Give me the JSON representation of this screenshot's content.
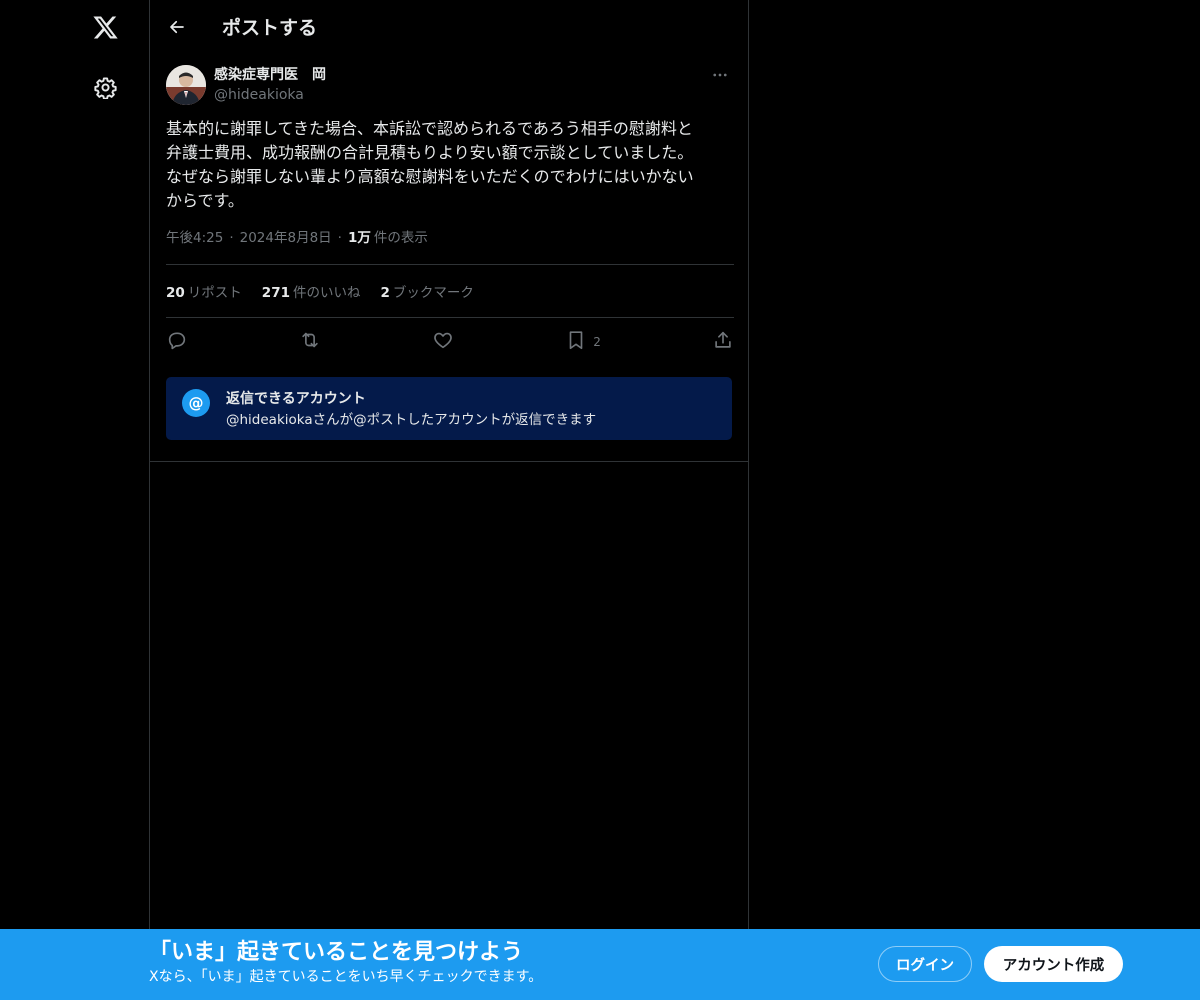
{
  "nav": {
    "logo_icon": "x-logo-icon",
    "settings_icon": "gear-icon"
  },
  "header": {
    "title": "ポストする",
    "back_icon": "arrow-left-icon"
  },
  "post": {
    "author_name": "感染症専門医　岡",
    "author_handle": "@hideakioka",
    "text": "基本的に謝罪してきた場合、本訴訟で認められるであろう相手の慰謝料と\n弁護士費用、成功報酬の合計見積もりより安い額で示談としていました。\nなぜなら謝罪しない輩より高額な慰謝料をいただくのでわけにはいかない\nからです。",
    "time": "午後4:25",
    "date": "2024年8月8日",
    "views_count": "1万",
    "views_label": "件の表示",
    "separator": "·"
  },
  "stats": {
    "reposts_count": "20",
    "reposts_label": "リポスト",
    "likes_count": "271",
    "likes_label": "件のいいね",
    "bookmarks_count": "2",
    "bookmarks_label": "ブックマーク"
  },
  "actions": {
    "bookmark_count": "2"
  },
  "reply_restriction": {
    "icon_glyph": "@",
    "title": "返信できるアカウント",
    "subtitle": "@hideakiokaさんが@ポストしたアカウントが返信できます"
  },
  "banner": {
    "title": "「いま」起きていることを見つけよう",
    "subtitle": "Xなら、「いま」起きていることをいち早くチェックできます。",
    "login_label": "ログイン",
    "signup_label": "アカウント作成"
  },
  "colors": {
    "background": "#000000",
    "text": "#e7e9ea",
    "muted": "#71767b",
    "border": "#2f3336",
    "accent": "#1d9bf0",
    "reply_card": "#041a4a"
  }
}
